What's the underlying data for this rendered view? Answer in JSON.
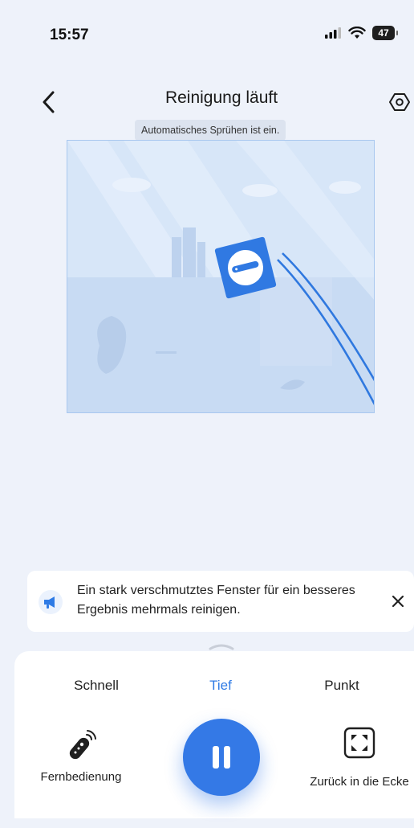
{
  "status_bar": {
    "time": "15:57",
    "battery": "47"
  },
  "header": {
    "title": "Reinigung läuft",
    "spray_notice": "Automatisches Sprühen ist ein."
  },
  "tip": {
    "text": "Ein stark verschmutztes Fenster für ein besseres Ergebnis mehrmals reinigen."
  },
  "modes": {
    "items": [
      "Schnell",
      "Tief",
      "Punkt"
    ],
    "selected": "Tief"
  },
  "controls": {
    "remote_label": "Fernbedienung",
    "corner_label": "Zurück in die Ecke"
  },
  "colors": {
    "accent": "#3479e6",
    "background": "#eef2fa",
    "map": "#cfe0f6"
  },
  "icons": [
    "back-icon",
    "settings-icon",
    "megaphone-icon",
    "close-icon",
    "remote-icon",
    "pause-icon",
    "expand-corners-icon"
  ]
}
